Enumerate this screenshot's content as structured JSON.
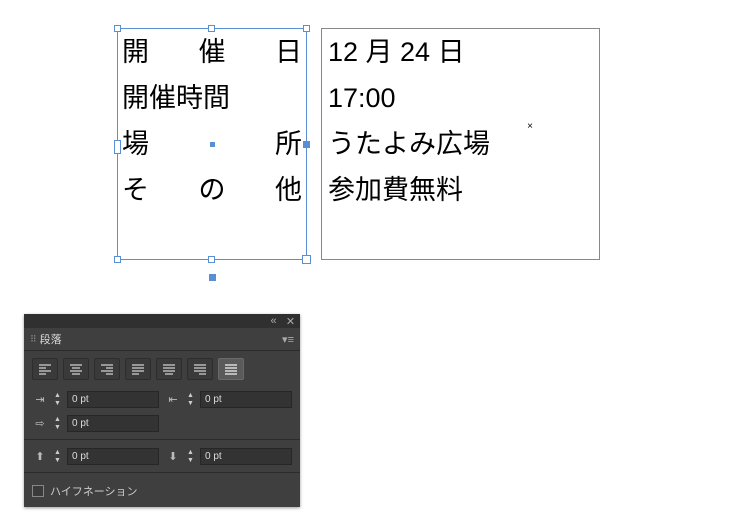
{
  "canvas": {
    "left": {
      "rows": [
        "開催日",
        "開催時間",
        "場所",
        "その他"
      ]
    },
    "right": {
      "rows": [
        "12 月 24 日",
        "17:00",
        "うたよみ広場",
        "参加費無料"
      ]
    }
  },
  "panel": {
    "tab_title": "段落",
    "align_buttons": [
      "align-left",
      "align-center",
      "align-right",
      "justify-left",
      "justify-center",
      "justify-right",
      "justify-full"
    ],
    "active_align_index": 6,
    "indent_left": "0 pt",
    "indent_right": "0 pt",
    "first_line": "0 pt",
    "space_before": "0 pt",
    "space_after": "0 pt",
    "hyphenation_label": "ハイフネーション"
  }
}
